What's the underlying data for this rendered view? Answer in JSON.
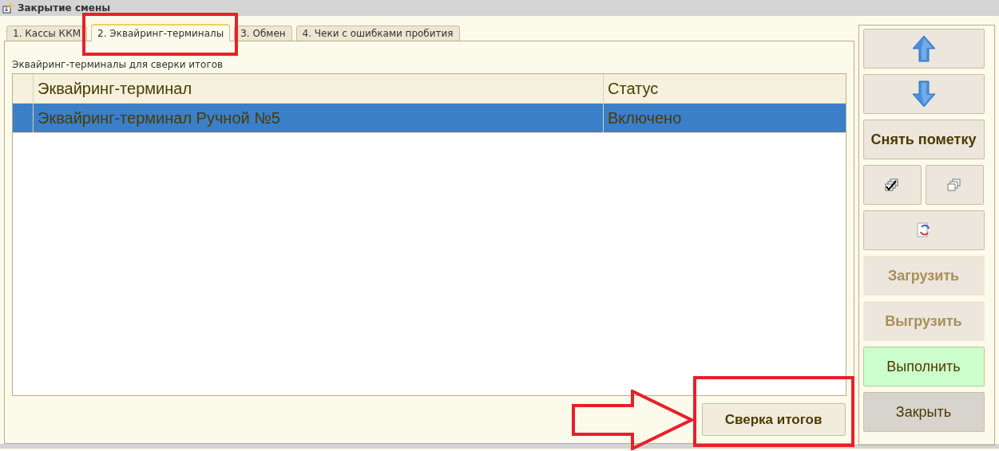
{
  "window": {
    "title": "Закрытие смены"
  },
  "tabs": [
    {
      "label": "1. Кассы ККМ",
      "selected": false,
      "annotated": false
    },
    {
      "label": "2. Эквайринг-терминалы",
      "selected": true,
      "annotated": true
    },
    {
      "label": "3. Обмен",
      "selected": false,
      "annotated": false
    },
    {
      "label": "4. Чеки с ошибками пробития",
      "selected": false,
      "annotated": false
    }
  ],
  "caption": "Эквайринг-терминалы для сверки итогов",
  "table": {
    "columns": [
      "Эквайринг-терминал",
      "Статус"
    ],
    "rows": [
      {
        "cells": [
          "Эквайринг-терминал Ручной №5",
          "Включено"
        ],
        "selected": true
      }
    ]
  },
  "summary_button": {
    "label": "Сверка итогов",
    "annotated": true
  },
  "side_buttons": [
    {
      "kind": "arrow-up",
      "disabled": false
    },
    {
      "kind": "arrow-down",
      "disabled": false
    },
    {
      "kind": "text",
      "label": "Снять пометку",
      "bold": true,
      "disabled": false
    },
    {
      "kind": "pair",
      "disabled": false
    },
    {
      "kind": "refresh",
      "disabled": false
    },
    {
      "kind": "text",
      "label": "Загрузить",
      "bold": true,
      "disabled": true
    },
    {
      "kind": "text",
      "label": "Выгрузить",
      "bold": true,
      "disabled": true
    },
    {
      "kind": "text",
      "label": "Выполнить",
      "bold": false,
      "disabled": false,
      "color": "#ccffcc"
    },
    {
      "kind": "text",
      "label": "Закрыть",
      "bold": false,
      "disabled": false,
      "color": "#d6d4cc"
    }
  ]
}
